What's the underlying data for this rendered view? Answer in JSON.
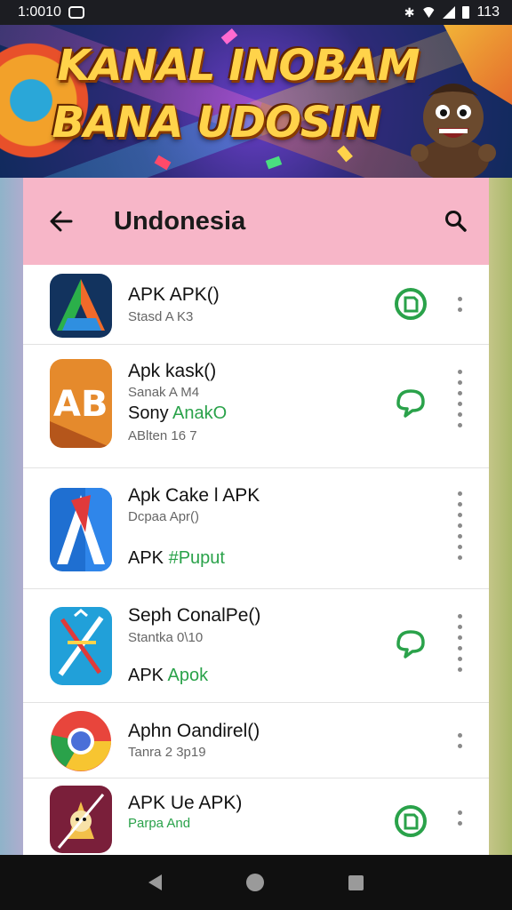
{
  "status_bar": {
    "time": "1:0010"
  },
  "banner": {
    "line1": "KANAL INOBAM",
    "line2": "BANA UDOSIN"
  },
  "appbar": {
    "title": "Undonesia"
  },
  "apps": [
    {
      "title": "APK  APK()",
      "sub": "Stasd A K3",
      "icon": "app-icon-a-triangle"
    },
    {
      "title": "Apk  kask()",
      "sub": "Sanak A M4",
      "line_prefix": "Sony ",
      "line_green": "AnakO",
      "sub2": "ABlten 16 7",
      "icon": "app-icon-ab"
    },
    {
      "title": "Apk Cake l APK",
      "sub": "Dcpaa Apr()",
      "line_prefix": "APK ",
      "line_green": "#Puput",
      "icon": "app-icon-a-blue"
    },
    {
      "title": "Seph ConalPe()",
      "sub": "Stantka 0\\10",
      "line_prefix": "APK ",
      "line_green": "Apok",
      "icon": "app-icon-tools"
    },
    {
      "title": "Aphn Oandirel()",
      "sub": "Tanra 2 3p19",
      "icon": "app-icon-chrome"
    },
    {
      "title": "APK Ue APK)",
      "sub": "Parpa And",
      "icon": "app-icon-fox"
    }
  ],
  "colors": {
    "accent_green": "#2aa24a",
    "appbar_pink": "#f7b6c8"
  }
}
